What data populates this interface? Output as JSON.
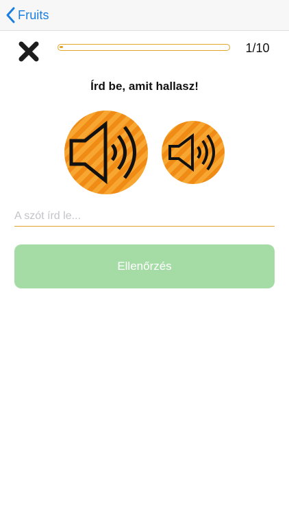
{
  "navbar": {
    "back_label": "Fruits",
    "back_icon": "chevron-left-icon"
  },
  "quiz": {
    "close_icon": "close-icon",
    "progress_fraction": 0.02,
    "counter": "1/10",
    "instruction": "Írd be, amit hallasz!",
    "speaker_normal_icon": "speaker-loud-icon",
    "speaker_slow_icon": "speaker-quiet-icon"
  },
  "answer": {
    "value": "",
    "placeholder": "A szót írd le..."
  },
  "check_button": {
    "label": "Ellenőrzés"
  },
  "colors": {
    "accent": "#e2a424",
    "link": "#1a7ee0",
    "speaker_light": "#f7a731",
    "speaker_dark": "#f08c16",
    "check_disabled": "#a5dca6"
  }
}
